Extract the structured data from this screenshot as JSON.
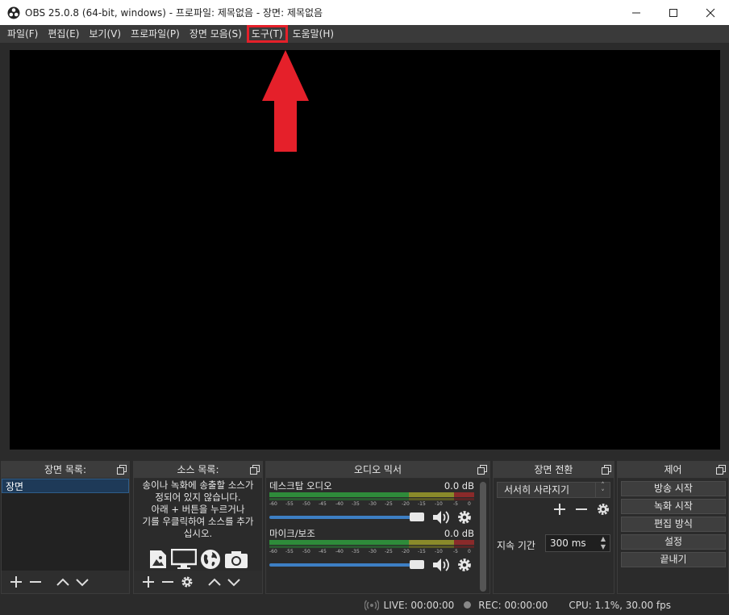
{
  "window": {
    "title": "OBS 25.0.8 (64-bit, windows) - 프로파일: 제목없음 - 장면: 제목없음"
  },
  "menu": {
    "items": [
      "파일(F)",
      "편집(E)",
      "보기(V)",
      "프로파일(P)",
      "장면 모음(S)",
      "도구(T)",
      "도움말(H)"
    ],
    "highlighted": "도구(T)"
  },
  "annotation": {
    "color": "#e5202a"
  },
  "scenes": {
    "title": "장면 목록:",
    "items": [
      "장면"
    ]
  },
  "sources": {
    "title": "소스 목록:",
    "hint_lines": [
      "송이나 녹화에 송출할 소스가",
      "정되어 있지 않습니다.",
      "아래 + 버튼을 누르거나",
      "기를 우클릭하여 소스를 추가",
      "십시오."
    ],
    "icons": [
      "image-icon",
      "monitor-icon",
      "globe-icon",
      "camera-icon"
    ]
  },
  "mixer": {
    "title": "오디오 믹서",
    "ticks": [
      "-60",
      "-55",
      "-50",
      "-45",
      "-40",
      "-35",
      "-30",
      "-25",
      "-20",
      "-15",
      "-10",
      "-5",
      "0"
    ],
    "channels": [
      {
        "name": "데스크탑 오디오",
        "level": "0.0 dB"
      },
      {
        "name": "마이크/보조",
        "level": "0.0 dB"
      }
    ]
  },
  "transitions": {
    "title": "장면 전환",
    "selected": "서서히 사라지기",
    "duration_label": "지속 기간",
    "duration_value": "300 ms"
  },
  "controls": {
    "title": "제어",
    "buttons": [
      "방송 시작",
      "녹화 시작",
      "편집 방식",
      "설정",
      "끝내기"
    ]
  },
  "status": {
    "live": "LIVE: 00:00:00",
    "rec": "REC: 00:00:00",
    "cpu": "CPU: 1.1%, 30.00 fps"
  }
}
